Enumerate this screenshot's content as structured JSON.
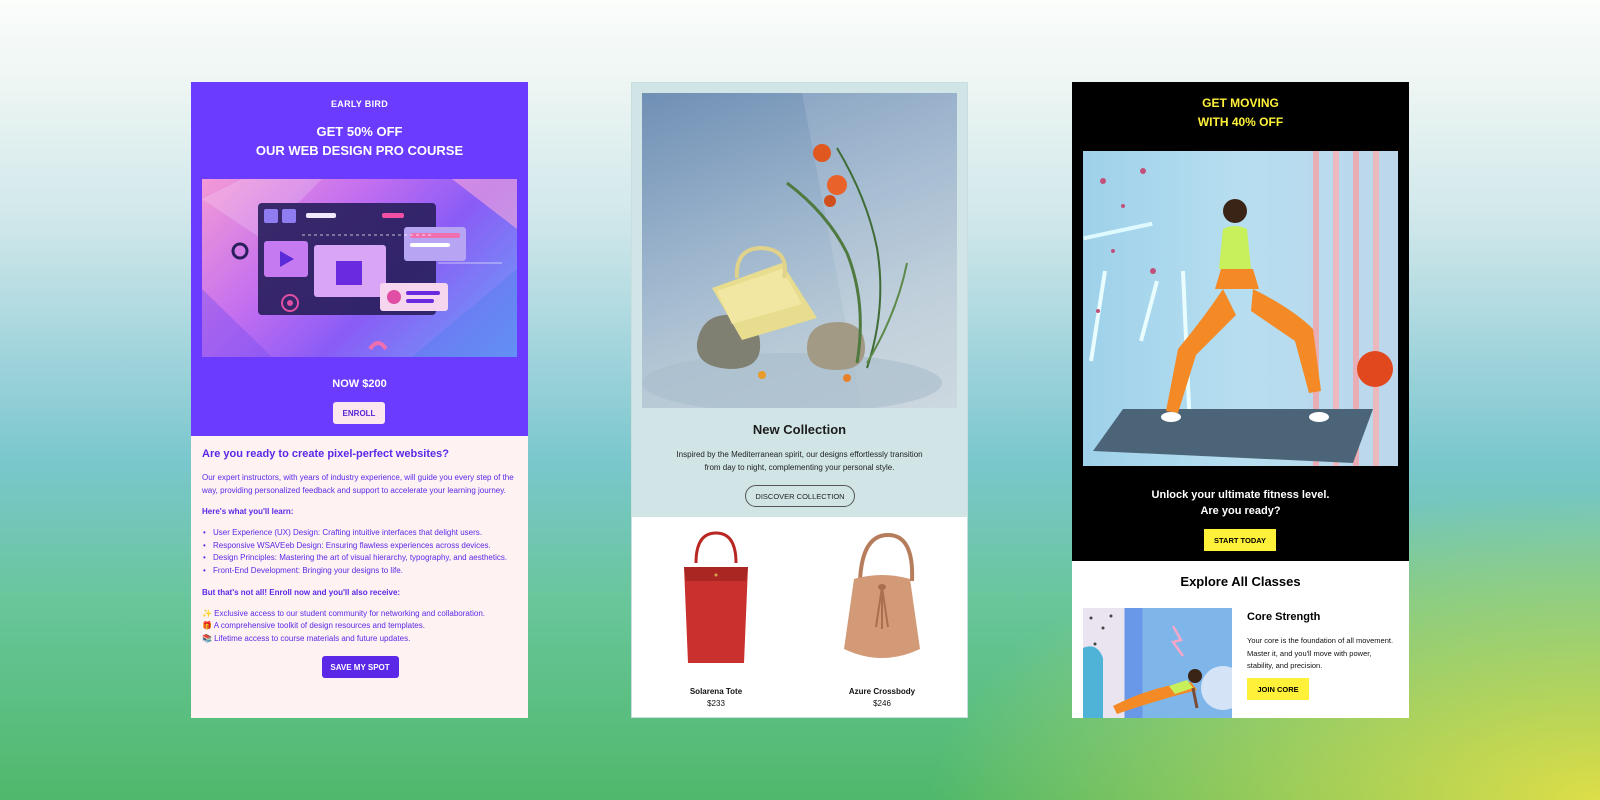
{
  "course": {
    "eyebrow": "EARLY BIRD",
    "title_line1": "GET 50% OFF",
    "title_line2": "OUR WEB DESIGN PRO COURSE",
    "price": "NOW $200",
    "enroll_label": "ENROLL",
    "question": "Are you ready to create pixel-perfect websites?",
    "intro": "Our expert instructors, with years of industry experience, will guide you every step of the way, providing personalized feedback and support to accelerate your learning journey.",
    "learn_heading": "Here's what you'll learn:",
    "learn_items": [
      "User Experience (UX) Design: Crafting intuitive interfaces that delight users.",
      "Responsive WSAVEeb Design: Ensuring flawless experiences across devices.",
      "Design Principles: Mastering the art of visual hierarchy, typography, and aesthetics.",
      "Front-End Development: Bringing your designs to life."
    ],
    "bonus_heading": "But that's not all! Enroll now and you'll also receive:",
    "bonus_items": [
      "✨ Exclusive access to our student community for networking and collaboration.",
      "🎁 A comprehensive toolkit of design resources and templates.",
      "📚 Lifetime access to course materials and future updates."
    ],
    "save_label": "SAVE MY SPOT",
    "colors": {
      "hero": "#6b3cff",
      "text": "#5b28e8",
      "body_bg": "#fef2f2"
    }
  },
  "collection": {
    "title": "New Collection",
    "description": "Inspired by the Mediterranean spirit, our designs effortlessly transition from day to night, complementing your personal style.",
    "discover_label": "DISCOVER COLLECTION",
    "products": [
      {
        "name": "Solarena Tote",
        "price": "$233",
        "color": "#c8312e"
      },
      {
        "name": "Azure Crossbody",
        "price": "$246",
        "color": "#d39a78"
      }
    ],
    "colors": {
      "panel": "#d1e5e7"
    }
  },
  "fitness": {
    "title_line1": "GET MOVING",
    "title_line2": "WITH 40% OFF",
    "sub_line1": "Unlock your ultimate fitness level.",
    "sub_line2": "Are you ready?",
    "start_label": "START TODAY",
    "explore": "Explore All Classes",
    "class_name": "Core Strength",
    "class_desc": "Your core is the foundation of all movement. Master it, and you'll move with power, stability, and precision.",
    "join_label": "JOIN CORE",
    "colors": {
      "accent": "#fff13a",
      "hero_bg": "#000000"
    }
  }
}
